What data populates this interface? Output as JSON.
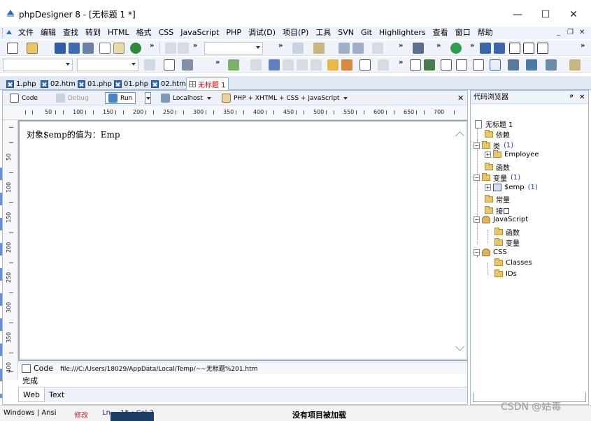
{
  "window": {
    "title": "phpDesigner 8 - [无标题 1 *]",
    "controls": {
      "minimize": "—",
      "maximize": "☐",
      "close": "✕"
    }
  },
  "menubar": {
    "items": [
      "文件",
      "编辑",
      "查找",
      "转到",
      "HTML",
      "格式",
      "CSS",
      "JavaScript",
      "PHP",
      "调试(D)",
      "项目(P)",
      "工具",
      "SVN",
      "Git",
      "Highlighters",
      "查看",
      "窗口",
      "帮助"
    ],
    "mdi_controls": {
      "minimize": "_",
      "restore": "❐",
      "close": "✕"
    }
  },
  "doc_tabs": [
    {
      "label": "1.php",
      "active": false
    },
    {
      "label": "02.htm",
      "active": false
    },
    {
      "label": "01.php",
      "active": false
    },
    {
      "label": "01.php",
      "active": false
    },
    {
      "label": "02.htm",
      "active": false
    },
    {
      "label": "无标题 1",
      "active": true
    }
  ],
  "editor_toolbar": {
    "code": "Code",
    "debug": "Debug",
    "run": "Run",
    "localhost": "Localhost",
    "syntax": "PHP + XHTML + CSS + JavaScript",
    "close": "✕"
  },
  "ruler": {
    "h_labels": [
      "50",
      "100",
      "150",
      "200",
      "250",
      "300",
      "350",
      "400",
      "450",
      "500",
      "550",
      "600",
      "650",
      "700"
    ],
    "v_labels": [
      "50",
      "100",
      "150",
      "200",
      "250",
      "300",
      "350",
      "400"
    ]
  },
  "editor": {
    "content": "对象$emp的值为：Emp"
  },
  "source_bar": {
    "label": "Code",
    "path": "file:///C:/Users/18029/AppData/Local/Temp/~~无标题%201.htm"
  },
  "status_done": "完成",
  "bottom_tabs": [
    "Web",
    "Text"
  ],
  "code_browser": {
    "title": "代码浏览器",
    "pin": "ᵖ",
    "close": "✕",
    "tree": [
      {
        "label": "无标题 1",
        "count": ""
      },
      {
        "label": "依赖",
        "count": ""
      },
      {
        "label": "类",
        "count": "(1)"
      },
      {
        "label": "Employee",
        "count": ""
      },
      {
        "label": "函数",
        "count": ""
      },
      {
        "label": "变量",
        "count": "(1)"
      },
      {
        "label": "$emp",
        "count": "(1)"
      },
      {
        "label": "常量",
        "count": ""
      },
      {
        "label": "接口",
        "count": ""
      },
      {
        "label": "JavaScript",
        "count": ""
      },
      {
        "label": "函数",
        "count": ""
      },
      {
        "label": "变量",
        "count": ""
      },
      {
        "label": "CSS",
        "count": ""
      },
      {
        "label": "Classes",
        "count": ""
      },
      {
        "label": "IDs",
        "count": ""
      }
    ]
  },
  "statusbar": {
    "encoding": "Windows | Ansi",
    "modified": "修改",
    "ln_label": "Ln",
    "position": "15 : Col  3",
    "project": "没有项目被加载"
  },
  "watermark": "CSDN @姑毒",
  "colors": {
    "accent": "#2f6db8",
    "modified": "#e02020",
    "count": "#2440c8",
    "active_tab": "#cc0000"
  }
}
